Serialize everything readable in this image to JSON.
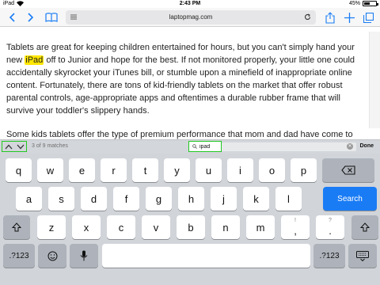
{
  "status_bar": {
    "device": "iPad",
    "time": "2:43 PM",
    "battery_percent": "45%",
    "battery_level": 0.45
  },
  "toolbar": {
    "url": "laptopmag.com"
  },
  "article": {
    "p1_before": "Tablets are great for keeping children entertained for hours, but you can't simply hand your new ",
    "p1_highlight": "iPad",
    "p1_after": " off to Junior and hope for the best. If not monitored properly, your little one could accidentally skyrocket your iTunes bill, or stumble upon a minefield of inappropriate online content. Fortunately, there are tons of kid-friendly tablets on the market that offer robust parental controls, age-appropriate apps and oftentimes a durable rubber frame that will survive your toddler's slippery hands.",
    "p2": "Some kids tablets offer the type of premium performance that mom and dad have come to"
  },
  "find_bar": {
    "matches": "3 of 9 matches",
    "query": "ipad",
    "done_label": "Done"
  },
  "keyboard": {
    "row1": [
      "q",
      "w",
      "e",
      "r",
      "t",
      "y",
      "u",
      "i",
      "o",
      "p"
    ],
    "row2": [
      "a",
      "s",
      "d",
      "f",
      "g",
      "h",
      "j",
      "k",
      "l"
    ],
    "search_label": "Search",
    "row3": [
      "z",
      "x",
      "c",
      "v",
      "b",
      "n",
      "m"
    ],
    "row3_punct": [
      {
        "sup": "!",
        "main": ","
      },
      {
        "sup": "?",
        "main": "."
      }
    ],
    "numbers_label": ".?123",
    "accent_color": "#1a7cf5",
    "highlight_color": "#ffe600"
  }
}
